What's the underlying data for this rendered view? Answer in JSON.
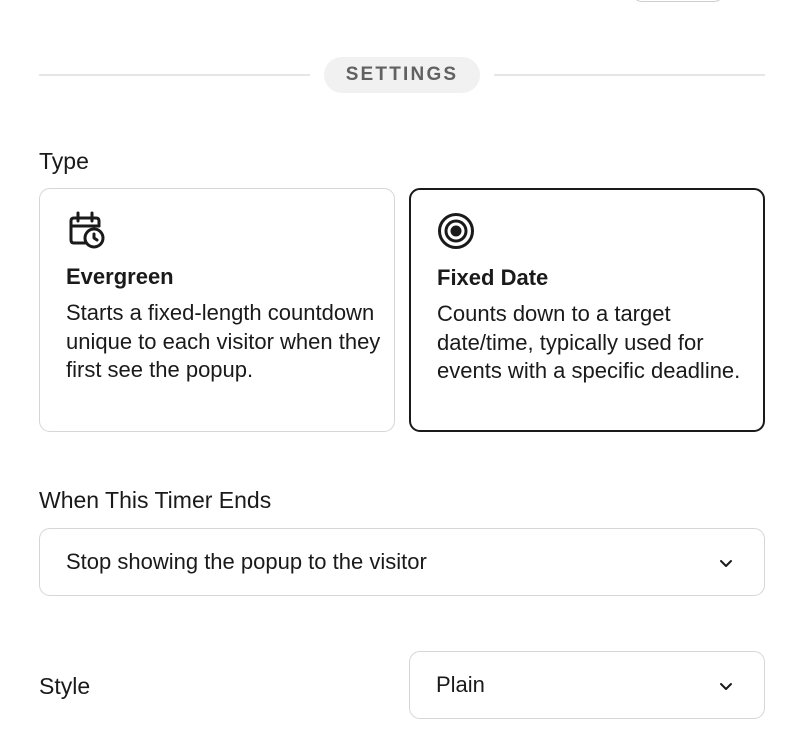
{
  "settings_section": {
    "title": "SETTINGS"
  },
  "type_field": {
    "label": "Type",
    "options": [
      {
        "title": "Evergreen",
        "description": "Starts a fixed-length countdown unique to each visitor when they first see the popup.",
        "icon": "calendar-clock-icon",
        "selected": false
      },
      {
        "title": "Fixed Date",
        "description": "Counts down to a target date/time, typically used for events with a specific deadline.",
        "icon": "target-icon",
        "selected": true
      }
    ]
  },
  "timer_end_field": {
    "label": "When This Timer Ends",
    "value": "Stop showing the popup to the visitor"
  },
  "style_field": {
    "label": "Style",
    "value": "Plain"
  },
  "colors": {
    "text": "#1a1a1a",
    "border": "#d6d6d6",
    "selected_border": "#1a1a1a",
    "pill_bg": "#f1f1f1",
    "pill_text": "#616161"
  }
}
